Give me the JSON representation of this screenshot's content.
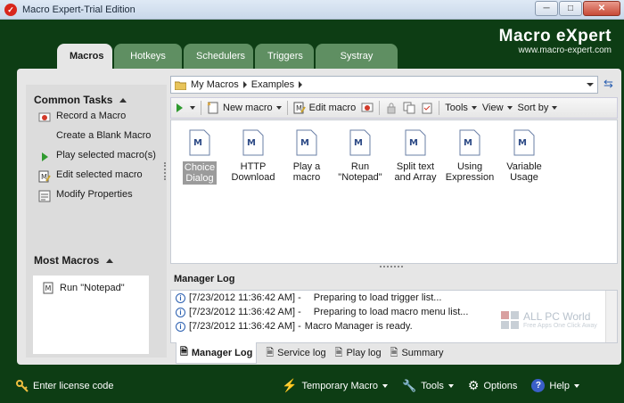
{
  "window": {
    "title": "Macro Expert-Trial Edition",
    "min": "─",
    "max": "□",
    "close": "✕"
  },
  "brand": {
    "name": "Macro eXpert",
    "url": "www.macro-expert.com"
  },
  "tabs": [
    "Macros",
    "Hotkeys",
    "Schedulers",
    "Triggers",
    "Systray Menu"
  ],
  "left": {
    "common_tasks_title": "Common Tasks",
    "tasks": [
      "Record a Macro",
      "Create a Blank Macro",
      "Play selected macro(s)",
      "Edit selected macro",
      "Modify Properties"
    ],
    "most_macros_title": "Most Macros",
    "most_macros": [
      "Run \"Notepad\""
    ]
  },
  "address": {
    "root": "My Macros",
    "folder": "Examples"
  },
  "toolbar": {
    "new_macro": "New macro",
    "edit_macro": "Edit macro",
    "tools": "Tools",
    "view": "View",
    "sort_by": "Sort by"
  },
  "macros": [
    {
      "l1": "Choice",
      "l2": "Dialog",
      "selected": true
    },
    {
      "l1": "HTTP",
      "l2": "Download"
    },
    {
      "l1": "Play a",
      "l2": "macro"
    },
    {
      "l1": "Run",
      "l2": "\"Notepad\""
    },
    {
      "l1": "Split text",
      "l2": "and Array"
    },
    {
      "l1": "Using",
      "l2": "Expression"
    },
    {
      "l1": "Variable",
      "l2": "Usage"
    }
  ],
  "log": {
    "title": "Manager Log",
    "lines": [
      {
        "ts": "[7/23/2012 11:36:42 AM] -",
        "msg": "Preparing to load trigger list..."
      },
      {
        "ts": "[7/23/2012 11:36:42 AM] -",
        "msg": "Preparing to load macro menu list..."
      },
      {
        "ts": "[7/23/2012 11:36:42 AM] -",
        "msg": "Macro Manager is ready."
      }
    ],
    "tabs": [
      "Manager Log",
      "Service log",
      "Play log",
      "Summary"
    ]
  },
  "watermark": {
    "name": "ALL PC World",
    "sub": "Free Apps One Click Away"
  },
  "bottom": {
    "license": "Enter license code",
    "temporary_macro": "Temporary Macro",
    "tools": "Tools",
    "options": "Options",
    "help": "Help"
  },
  "colors": {
    "frame": "#0d3d14",
    "tab_inactive": "#5f8f62",
    "panel": "#e6e6e6",
    "selected_label": "#9b9b9b"
  }
}
